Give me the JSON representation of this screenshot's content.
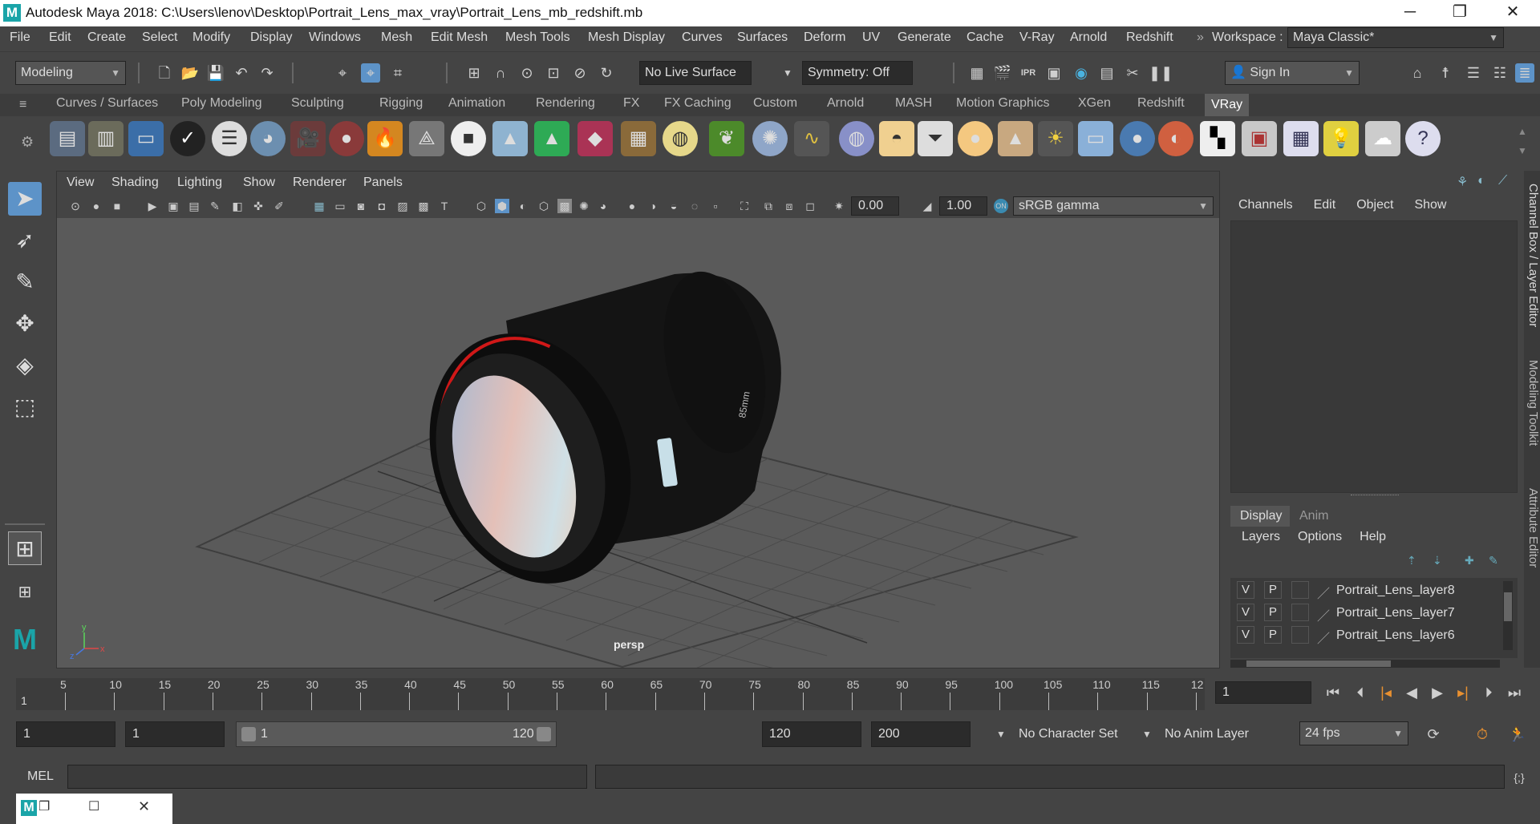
{
  "window": {
    "title": "Autodesk Maya 2018: C:\\Users\\lenov\\Desktop\\Portrait_Lens_max_vray\\Portrait_Lens_mb_redshift.mb",
    "logo": "M",
    "minimize": "─",
    "maximize": "❐",
    "close": "✕"
  },
  "menu": [
    "File",
    "Edit",
    "Create",
    "Select",
    "Modify",
    "Display",
    "Windows",
    "Mesh",
    "Edit Mesh",
    "Mesh Tools",
    "Mesh Display",
    "Curves",
    "Surfaces",
    "Deform",
    "UV",
    "Generate",
    "Cache",
    "V-Ray",
    "Arnold",
    "Redshift"
  ],
  "workspace": {
    "label": "Workspace :",
    "value": "Maya Classic*"
  },
  "toolbar": {
    "mode": "Modeling",
    "live_surface": "No Live Surface",
    "symmetry": "Symmetry: Off",
    "sign_in": "Sign In"
  },
  "shelf_tabs": [
    "Curves / Surfaces",
    "Poly Modeling",
    "Sculpting",
    "Rigging",
    "Animation",
    "Rendering",
    "FX",
    "FX Caching",
    "Custom",
    "Arnold",
    "MASH",
    "Motion Graphics",
    "XGen",
    "Redshift",
    "VRay"
  ],
  "active_shelf_tab": "VRay",
  "viewport": {
    "menu": [
      "View",
      "Shading",
      "Lighting",
      "Show",
      "Renderer",
      "Panels"
    ],
    "exposure": "0.00",
    "gamma": "1.00",
    "color_space": "sRGB gamma",
    "camera": "persp",
    "lens_text": "85mm"
  },
  "channel_box": {
    "menu": [
      "Channels",
      "Edit",
      "Object",
      "Show"
    ]
  },
  "layer_editor": {
    "tabs": [
      "Display",
      "Anim"
    ],
    "menu": [
      "Layers",
      "Options",
      "Help"
    ],
    "layers": [
      {
        "v": "V",
        "p": "P",
        "name": "Portrait_Lens_layer8"
      },
      {
        "v": "V",
        "p": "P",
        "name": "Portrait_Lens_layer7"
      },
      {
        "v": "V",
        "p": "P",
        "name": "Portrait_Lens_layer6"
      }
    ]
  },
  "side_tabs": [
    "Channel Box / Layer Editor",
    "Modeling Toolkit",
    "Attribute Editor"
  ],
  "timeline": {
    "ticks": [
      "5",
      "10",
      "15",
      "20",
      "25",
      "30",
      "35",
      "40",
      "45",
      "50",
      "55",
      "60",
      "65",
      "70",
      "75",
      "80",
      "85",
      "90",
      "95",
      "100",
      "105",
      "110",
      "115",
      "12"
    ],
    "start": "1",
    "current": "1"
  },
  "range": {
    "start": "1",
    "playback_start": "1",
    "slider_start": "1",
    "slider_end": "120",
    "playback_end": "120",
    "end": "200",
    "character_set": "No Character Set",
    "anim_layer": "No Anim Layer",
    "fps": "24 fps"
  },
  "command": {
    "label": "MEL"
  },
  "colors": {
    "accent": "#5d93c8",
    "lens_ring": "#d01818",
    "bg": "#444444",
    "viewport": "#5a5a5a"
  }
}
